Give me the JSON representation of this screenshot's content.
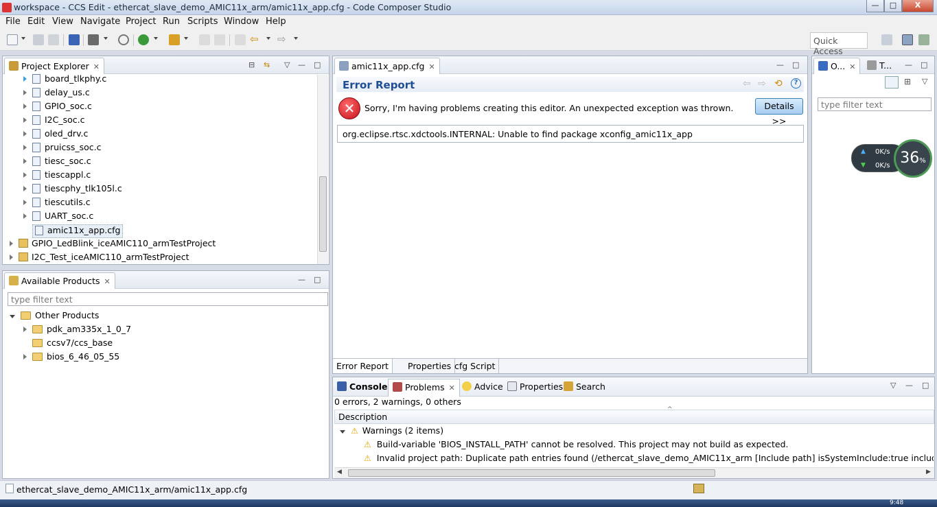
{
  "window": {
    "title": "workspace - CCS Edit - ethercat_slave_demo_AMIC11x_arm/amic11x_app.cfg - Code Composer Studio",
    "minimize_label": "—",
    "maximize_label": "□",
    "close_label": "X"
  },
  "menu": [
    "File",
    "Edit",
    "View",
    "Navigate",
    "Project",
    "Run",
    "Scripts",
    "Window",
    "Help"
  ],
  "toolbar": {
    "quick_access_placeholder": "Quick Access"
  },
  "project_explorer": {
    "tab_label": "Project Explorer",
    "files": [
      "board_tlkphy.c",
      "delay_us.c",
      "GPIO_soc.c",
      "I2C_soc.c",
      "oled_drv.c",
      "pruicss_soc.c",
      "tiesc_soc.c",
      "tiescappl.c",
      "tiescphy_tlk105l.c",
      "tiescutils.c",
      "UART_soc.c",
      "amic11x_app.cfg"
    ],
    "projects": [
      "GPIO_LedBlink_iceAMIC110_armTestProject",
      "I2C_Test_iceAMIC110_armTestProject"
    ]
  },
  "available_products": {
    "tab_label": "Available Products",
    "filter_placeholder": "type filter text",
    "root": "Other Products",
    "items": [
      "pdk_am335x_1_0_7",
      "ccsv7/ccs_base",
      "bios_6_46_05_55"
    ]
  },
  "editor": {
    "tab_label": "amic11x_app.cfg",
    "header": "Error Report",
    "message": "Sorry, I'm having problems creating this editor. An unexpected exception was thrown.",
    "details_button": "Details >>",
    "exception": "org.eclipse.rtsc.xdctools.INTERNAL: Unable to find package xconfig_amic11x_app",
    "bottom_tabs": [
      "Error Report",
      "Properties",
      "cfg Script"
    ]
  },
  "outline": {
    "tab1_label": "O...",
    "tab2_label": "T...",
    "filter_placeholder": "type filter text"
  },
  "net_widget": {
    "up": "0K/s",
    "down": "0K/s",
    "percent": "36",
    "percent_unit": "%"
  },
  "console": {
    "tabs": [
      "Console",
      "Problems",
      "Advice",
      "Properties",
      "Search"
    ],
    "summary": "0 errors, 2 warnings, 0 others",
    "column": "Description",
    "group": "Warnings (2 items)",
    "warnings": [
      "Build-variable 'BIOS_INSTALL_PATH' cannot be resolved. This project may not build as expected.",
      "Invalid project path: Duplicate path entries found (/ethercat_slave_demo_AMIC11x_arm [Include path] isSystemInclude:true includePath:C:/ti/p"
    ]
  },
  "status": {
    "path": "ethercat_slave_demo_AMIC11x_arm/amic11x_app.cfg",
    "clock": "9:48"
  },
  "colors": {
    "accent": "#1f4e97",
    "error_red": "#d9202a",
    "warning": "#f2b400",
    "details_btn": "#bcd9f5"
  }
}
